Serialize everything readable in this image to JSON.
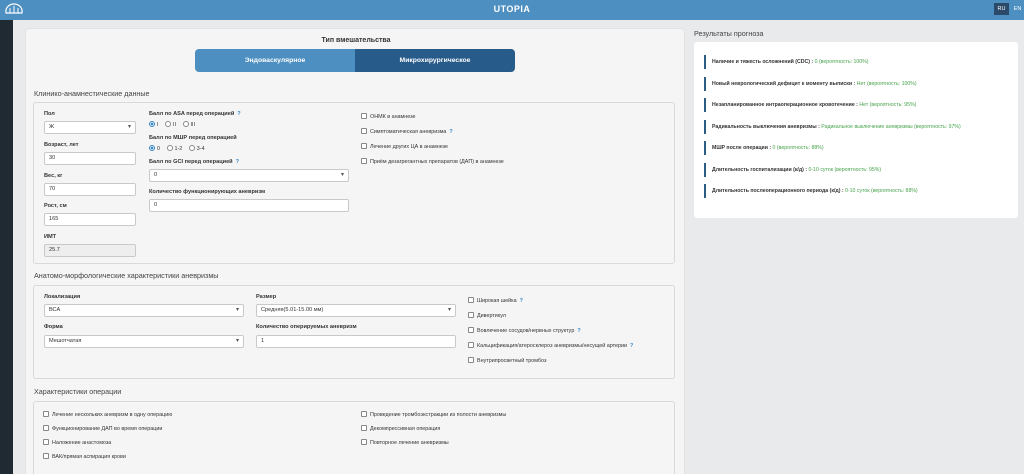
{
  "app": {
    "title": "UTOPIA",
    "lang_ru": "RU",
    "lang_en": "EN"
  },
  "intervention": {
    "title": "Тип вмешательства",
    "endo_label": "Эндоваскулярное",
    "micro_label": "Микрохирургическое"
  },
  "clinical": {
    "title": "Клинико-анамнестические данные",
    "sex_label": "Пол",
    "sex_value": "Ж",
    "age_label": "Возраст, лет",
    "age_value": "30",
    "weight_label": "Вес, кг",
    "weight_value": "70",
    "height_label": "Рост, см",
    "height_value": "165",
    "bmi_label": "ИМТ",
    "bmi_value": "25.7",
    "asa_label": "Балл по ASA перед операцией",
    "asa_help": "?",
    "asa_options": [
      "I",
      "II",
      "III"
    ],
    "mrs_label": "Балл по МШР перед операцией",
    "mrs_options": [
      "0",
      "1-2",
      "3-4"
    ],
    "gcs_label": "Балл по GCI перед операцией",
    "gcs_help": "?",
    "gcs_value": "0",
    "func_label": "Количество функционирующих аневризм",
    "func_value": "0",
    "checkboxes": [
      {
        "label": "ОНМК в анамнезе",
        "help": ""
      },
      {
        "label": "Симптоматическая аневризма",
        "help": "?"
      },
      {
        "label": "Лечение других ЦА в анамнезе",
        "help": ""
      },
      {
        "label": "Приём дезагрегантных препаратов (ДАП) в анамнезе",
        "help": ""
      }
    ]
  },
  "anatomy": {
    "title": "Анатомо-морфологические характеристики аневризмы",
    "loc_label": "Локализация",
    "loc_value": "ВСА",
    "size_label": "Размер",
    "size_value": "Средняя(5.01-15.00 мм)",
    "form_label": "Форма",
    "form_value": "Мешотчатая",
    "count_label": "Количество оперируемых аневризм",
    "count_value": "1",
    "checkboxes": [
      {
        "label": "Широкая шейка",
        "help": "?"
      },
      {
        "label": "Дивертикул",
        "help": ""
      },
      {
        "label": "Вовлечение сосудов/нервных структур",
        "help": "?"
      },
      {
        "label": "Кальцификация/атеросклероз аневризмы/несущей артерии",
        "help": "?"
      },
      {
        "label": "Внутрипросветный тромбоз",
        "help": ""
      }
    ]
  },
  "operation": {
    "title": "Характеристики операции",
    "checkboxes": [
      {
        "label": "Лечение нескольких аневризм в одну операцию"
      },
      {
        "label": "Функционирование ДАП во время операции"
      },
      {
        "label": "Наложение анастомоза"
      },
      {
        "label": "ВАК/прямая аспирация крови"
      },
      {
        "label": "Проведение тромбоэкстракции из полости аневризмы"
      },
      {
        "label": "Декомпрессивная операция"
      },
      {
        "label": "Повторное лечение аневризмы"
      }
    ]
  },
  "results": {
    "title": "Результаты прогноза",
    "rows": [
      {
        "key": "Наличие и тяжесть осложнений (CDC) :",
        "value": "0",
        "prob": "(вероятность: 100%)"
      },
      {
        "key": "Новый неврологический дефицит к моменту выписки :",
        "value": "Нет",
        "prob": "(вероятность: 100%)"
      },
      {
        "key": "Незапланированное интраоперационное кровотечение :",
        "value": "Нет",
        "prob": "(вероятность: 95%)"
      },
      {
        "key": "Радикальность выключения аневризмы :",
        "value": "Радикальное выключение аневризмы",
        "prob": "(вероятность: 97%)"
      },
      {
        "key": "МШР после операции :",
        "value": "0",
        "prob": "(вероятность: 88%)"
      },
      {
        "key": "Длительность госпитализации (к/д) :",
        "value": "0-10 суток",
        "prob": "(вероятность: 95%)"
      },
      {
        "key": "Длительность послеоперационного периода (к/д) :",
        "value": "0-10 суток",
        "prob": "(вероятность: 88%)"
      }
    ]
  }
}
